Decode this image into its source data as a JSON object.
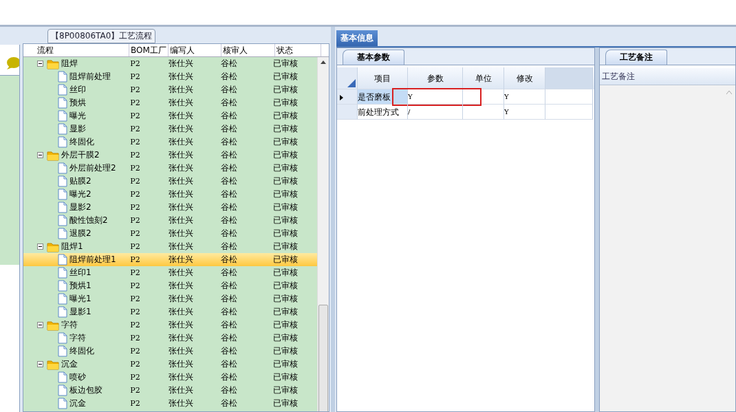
{
  "process_panel": {
    "title": "【8P00806TA0】工艺流程",
    "columns": [
      "流程",
      "BOM工厂",
      "编写人",
      "核审人",
      "状态"
    ],
    "tree": [
      {
        "name": "阻焊",
        "kind": "folder",
        "expanded": true,
        "selected": false,
        "bom": "P2",
        "writer": "张仕兴",
        "reviewer": "谷松",
        "status": "已审核",
        "children": [
          {
            "name": "阻焊前处理",
            "kind": "step",
            "selected": false,
            "bom": "P2",
            "writer": "张仕兴",
            "reviewer": "谷松",
            "status": "已审核"
          },
          {
            "name": "丝印",
            "kind": "step",
            "selected": false,
            "bom": "P2",
            "writer": "张仕兴",
            "reviewer": "谷松",
            "status": "已审核"
          },
          {
            "name": "预烘",
            "kind": "step",
            "selected": false,
            "bom": "P2",
            "writer": "张仕兴",
            "reviewer": "谷松",
            "status": "已审核"
          },
          {
            "name": "曝光",
            "kind": "step",
            "selected": false,
            "bom": "P2",
            "writer": "张仕兴",
            "reviewer": "谷松",
            "status": "已审核"
          },
          {
            "name": "显影",
            "kind": "step",
            "selected": false,
            "bom": "P2",
            "writer": "张仕兴",
            "reviewer": "谷松",
            "status": "已审核"
          },
          {
            "name": "终固化",
            "kind": "step",
            "selected": false,
            "bom": "P2",
            "writer": "张仕兴",
            "reviewer": "谷松",
            "status": "已审核"
          }
        ]
      },
      {
        "name": "外层干膜2",
        "kind": "folder",
        "expanded": true,
        "selected": false,
        "bom": "P2",
        "writer": "张仕兴",
        "reviewer": "谷松",
        "status": "已审核",
        "children": [
          {
            "name": "外层前处理2",
            "kind": "step",
            "selected": false,
            "bom": "P2",
            "writer": "张仕兴",
            "reviewer": "谷松",
            "status": "已审核"
          },
          {
            "name": "贴膜2",
            "kind": "step",
            "selected": false,
            "bom": "P2",
            "writer": "张仕兴",
            "reviewer": "谷松",
            "status": "已审核"
          },
          {
            "name": "曝光2",
            "kind": "step",
            "selected": false,
            "bom": "P2",
            "writer": "张仕兴",
            "reviewer": "谷松",
            "status": "已审核"
          },
          {
            "name": "显影2",
            "kind": "step",
            "selected": false,
            "bom": "P2",
            "writer": "张仕兴",
            "reviewer": "谷松",
            "status": "已审核"
          },
          {
            "name": "酸性蚀刻2",
            "kind": "step",
            "selected": false,
            "bom": "P2",
            "writer": "张仕兴",
            "reviewer": "谷松",
            "status": "已审核"
          },
          {
            "name": "退膜2",
            "kind": "step",
            "selected": false,
            "bom": "P2",
            "writer": "张仕兴",
            "reviewer": "谷松",
            "status": "已审核"
          }
        ]
      },
      {
        "name": "阻焊1",
        "kind": "folder",
        "expanded": true,
        "selected": false,
        "bom": "P2",
        "writer": "张仕兴",
        "reviewer": "谷松",
        "status": "已审核",
        "children": [
          {
            "name": "阻焊前处理1",
            "kind": "step",
            "selected": true,
            "bom": "P2",
            "writer": "张仕兴",
            "reviewer": "谷松",
            "status": "已审核"
          },
          {
            "name": "丝印1",
            "kind": "step",
            "selected": false,
            "bom": "P2",
            "writer": "张仕兴",
            "reviewer": "谷松",
            "status": "已审核"
          },
          {
            "name": "预烘1",
            "kind": "step",
            "selected": false,
            "bom": "P2",
            "writer": "张仕兴",
            "reviewer": "谷松",
            "status": "已审核"
          },
          {
            "name": "曝光1",
            "kind": "step",
            "selected": false,
            "bom": "P2",
            "writer": "张仕兴",
            "reviewer": "谷松",
            "status": "已审核"
          },
          {
            "name": "显影1",
            "kind": "step",
            "selected": false,
            "bom": "P2",
            "writer": "张仕兴",
            "reviewer": "谷松",
            "status": "已审核"
          }
        ]
      },
      {
        "name": "字符",
        "kind": "folder",
        "expanded": true,
        "selected": false,
        "bom": "P2",
        "writer": "张仕兴",
        "reviewer": "谷松",
        "status": "已审核",
        "children": [
          {
            "name": "字符",
            "kind": "step",
            "selected": false,
            "bom": "P2",
            "writer": "张仕兴",
            "reviewer": "谷松",
            "status": "已审核"
          },
          {
            "name": "终固化",
            "kind": "step",
            "selected": false,
            "bom": "P2",
            "writer": "张仕兴",
            "reviewer": "谷松",
            "status": "已审核"
          }
        ]
      },
      {
        "name": "沉金",
        "kind": "folder",
        "expanded": true,
        "selected": false,
        "bom": "P2",
        "writer": "张仕兴",
        "reviewer": "谷松",
        "status": "已审核",
        "children": [
          {
            "name": "喷砂",
            "kind": "step",
            "selected": false,
            "bom": "P2",
            "writer": "张仕兴",
            "reviewer": "谷松",
            "status": "已审核"
          },
          {
            "name": "板边包胶",
            "kind": "step",
            "selected": false,
            "bom": "P2",
            "writer": "张仕兴",
            "reviewer": "谷松",
            "status": "已审核"
          },
          {
            "name": "沉金",
            "kind": "step",
            "selected": false,
            "bom": "P2",
            "writer": "张仕兴",
            "reviewer": "谷松",
            "status": "已审核"
          }
        ]
      }
    ]
  },
  "tabs": [
    {
      "label": "基本信息",
      "selected": true
    }
  ],
  "params_panel": {
    "tab": {
      "label": "基本参数",
      "selected": true
    },
    "columns": [
      "项目",
      "参数",
      "单位",
      "修改"
    ],
    "rows": [
      {
        "current": true,
        "highlighted": true,
        "cells": [
          "是否磨板",
          "Y",
          "",
          "Y"
        ]
      },
      {
        "current": false,
        "highlighted": false,
        "cells": [
          "前处理方式",
          "/",
          "",
          "Y"
        ]
      }
    ]
  },
  "notes_panel": {
    "tab": {
      "label": "工艺备注",
      "selected": true
    },
    "header": "工艺备注"
  }
}
